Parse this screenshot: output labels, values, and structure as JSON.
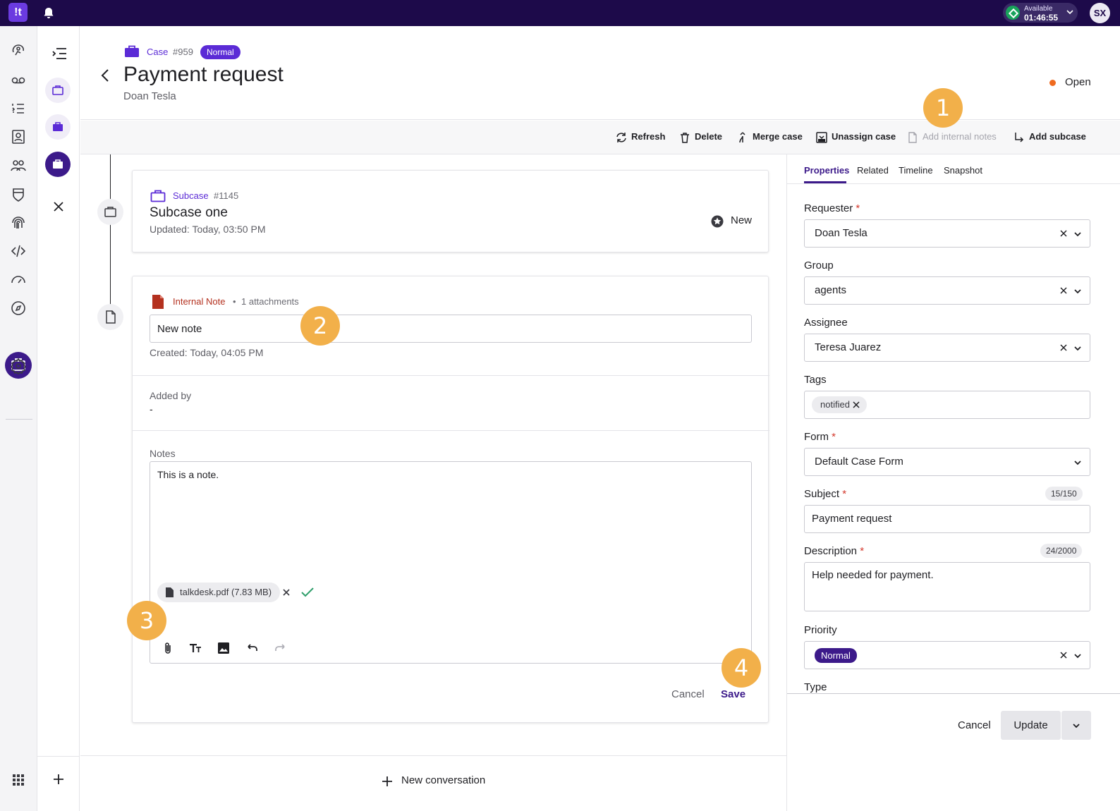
{
  "topbar": {
    "logo_text": "!t",
    "status_label": "Available",
    "status_time": "01:46:55",
    "avatar_initials": "SX"
  },
  "header": {
    "case_label": "Case",
    "case_number": "#959",
    "priority_badge": "Normal",
    "title": "Payment request",
    "subtitle": "Doan Tesla",
    "status": "Open"
  },
  "toolbar": {
    "refresh": "Refresh",
    "delete": "Delete",
    "merge": "Merge case",
    "unassign": "Unassign case",
    "add_notes": "Add internal notes",
    "add_subcase": "Add subcase"
  },
  "subcase": {
    "label": "Subcase",
    "number": "#1145",
    "title": "Subcase one",
    "updated": "Updated: Today, 03:50 PM",
    "status": "New"
  },
  "note": {
    "label": "Internal Note",
    "separator": "•",
    "attachments": "1 attachments",
    "title_value": "New note",
    "created": "Created: Today, 04:05 PM",
    "added_by_label": "Added by",
    "added_by_value": "-",
    "notes_label": "Notes",
    "notes_text": "This is a note.",
    "attachment_name": "talkdesk.pdf (7.83 MB)",
    "cancel": "Cancel",
    "save": "Save"
  },
  "conversation": {
    "new_label": "New conversation"
  },
  "sidepanel": {
    "tabs": [
      "Properties",
      "Related",
      "Timeline",
      "Snapshot"
    ],
    "requester_label": "Requester",
    "requester_value": "Doan Tesla",
    "group_label": "Group",
    "group_value": "agents",
    "assignee_label": "Assignee",
    "assignee_value": "Teresa Juarez",
    "tags_label": "Tags",
    "tag_value": "notified",
    "form_label": "Form",
    "form_value": "Default Case Form",
    "subject_label": "Subject",
    "subject_counter": "15/150",
    "subject_value": "Payment request",
    "description_label": "Description",
    "description_counter": "24/2000",
    "description_value": "Help needed for payment.",
    "priority_label": "Priority",
    "priority_value": "Normal",
    "type_label": "Type",
    "required_mark": "*",
    "cancel": "Cancel",
    "update": "Update"
  },
  "callouts": [
    "1",
    "2",
    "3",
    "4"
  ],
  "colors": {
    "topbar": "#1d0a4a",
    "accent": "#3c1a8a",
    "brand_purple": "#5b2bd6",
    "note_red": "#b4311f",
    "status_open": "#ef6a1f",
    "callout": "#f2b04a"
  }
}
